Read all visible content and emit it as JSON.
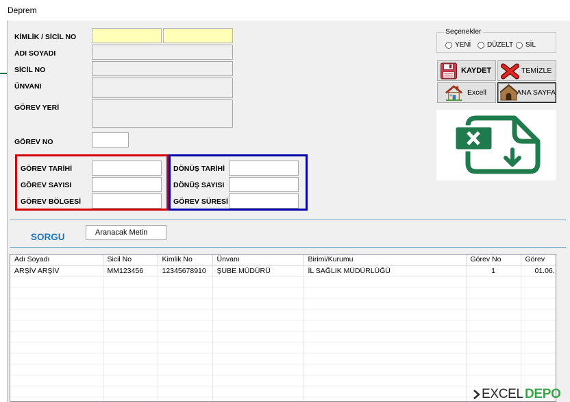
{
  "window": {
    "title": "Deprem"
  },
  "form": {
    "kimlik_sicil_no": {
      "label": "KİMLİK / SİCİL NO",
      "value_1": "",
      "value_2": ""
    },
    "adi_soyadi": {
      "label": "ADI SOYADI",
      "value": ""
    },
    "sicil_no": {
      "label": "SİCİL NO",
      "value": ""
    },
    "unvani": {
      "label": "ÜNVANI",
      "value": ""
    },
    "gorev_yeri": {
      "label": "GÖREV YERİ",
      "value": ""
    },
    "gorev_no": {
      "label": "GÖREV NO",
      "value": ""
    }
  },
  "gorev_group": {
    "gorev_tarihi": {
      "label": "GÖREV TARİHİ",
      "value": ""
    },
    "gorev_sayisi": {
      "label": "GÖREV SAYISI",
      "value": ""
    },
    "gorev_bolgesi": {
      "label": "GÖREV BÖLGESİ",
      "value": ""
    }
  },
  "donus_group": {
    "donus_tarihi": {
      "label": "DÖNÜŞ TARİHİ",
      "value": ""
    },
    "donus_sayisi": {
      "label": "DÖNÜŞ SAYISI",
      "value": ""
    },
    "gorev_suresi": {
      "label": "GÖREV SÜRESİ",
      "value": ""
    }
  },
  "options": {
    "title": "Seçenekler",
    "items": [
      {
        "label": "YENİ",
        "selected": false
      },
      {
        "label": "DÜZELT",
        "selected": false
      },
      {
        "label": "SİL",
        "selected": false
      }
    ]
  },
  "buttons": {
    "save": "KAYDET",
    "clear": "TEMİZLE",
    "excel": "Excell",
    "home": "ANA SAYFA"
  },
  "icons": {
    "save": "floppy-disk-icon",
    "clear": "red-x-icon",
    "excel": "house-icon",
    "home": "home-icon",
    "export": "excel-download-icon"
  },
  "query": {
    "label": "SORGU",
    "search_value": "Aranacak Metin"
  },
  "table": {
    "columns": [
      "Adı Soyadı",
      "Sicil No",
      "Kimlik No",
      "Ünvanı",
      "Birimi/Kurumu",
      "Görev No",
      "Görev"
    ],
    "rows": [
      [
        "ARŞİV ARŞİV",
        "MM123456",
        "12345678910",
        "ŞUBE MÜDÜRÜ",
        "İL SAĞLIK MÜDÜRLÜĞÜ",
        "1",
        "01.06."
      ]
    ]
  },
  "brand": {
    "part1": "EXCEL",
    "part2": "DEPO"
  },
  "colors": {
    "required_field": "#ffffb8",
    "gorev_group_border": "#d40000",
    "donus_group_border": "#0000a8",
    "sorgu_label": "#1b75bc",
    "divider": "#6fa8c4",
    "excel_green": "#1f7a4c",
    "brand_green": "#3aa54a"
  }
}
